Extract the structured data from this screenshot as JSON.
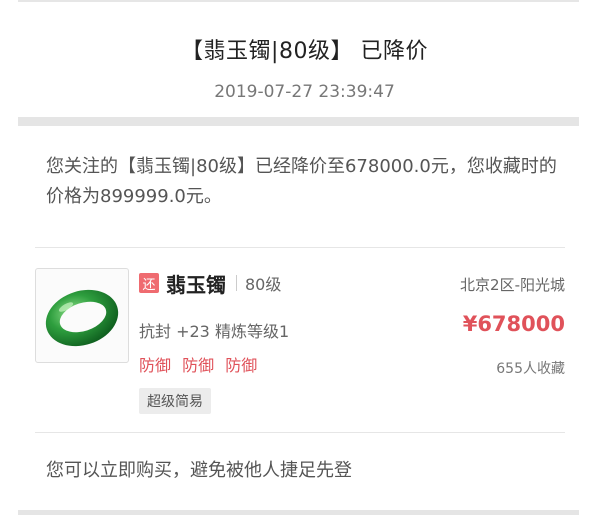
{
  "notification": {
    "title": "【翡玉镯|80级】 已降价",
    "timestamp": "2019-07-27 23:39:47",
    "message": "您关注的【翡玉镯|80级】已经降价至678000.0元，您收藏时的价格为899999.0元。",
    "footer": "您可以立即购买，避免被他人捷足先登"
  },
  "item": {
    "badge": "还",
    "name": "翡玉镯",
    "level": "80级",
    "location": "北京2区-阳光城",
    "attrs": "抗封 +23 精炼等级1",
    "price": "¥678000",
    "defense": [
      "防御",
      "防御",
      "防御"
    ],
    "favorites": "655人收藏",
    "tag": "超级简易",
    "image_icon": "jade-bracelet-icon"
  },
  "colors": {
    "accent": "#e0525a",
    "badge": "#ef6b70",
    "jade": "#2e9e3e"
  }
}
